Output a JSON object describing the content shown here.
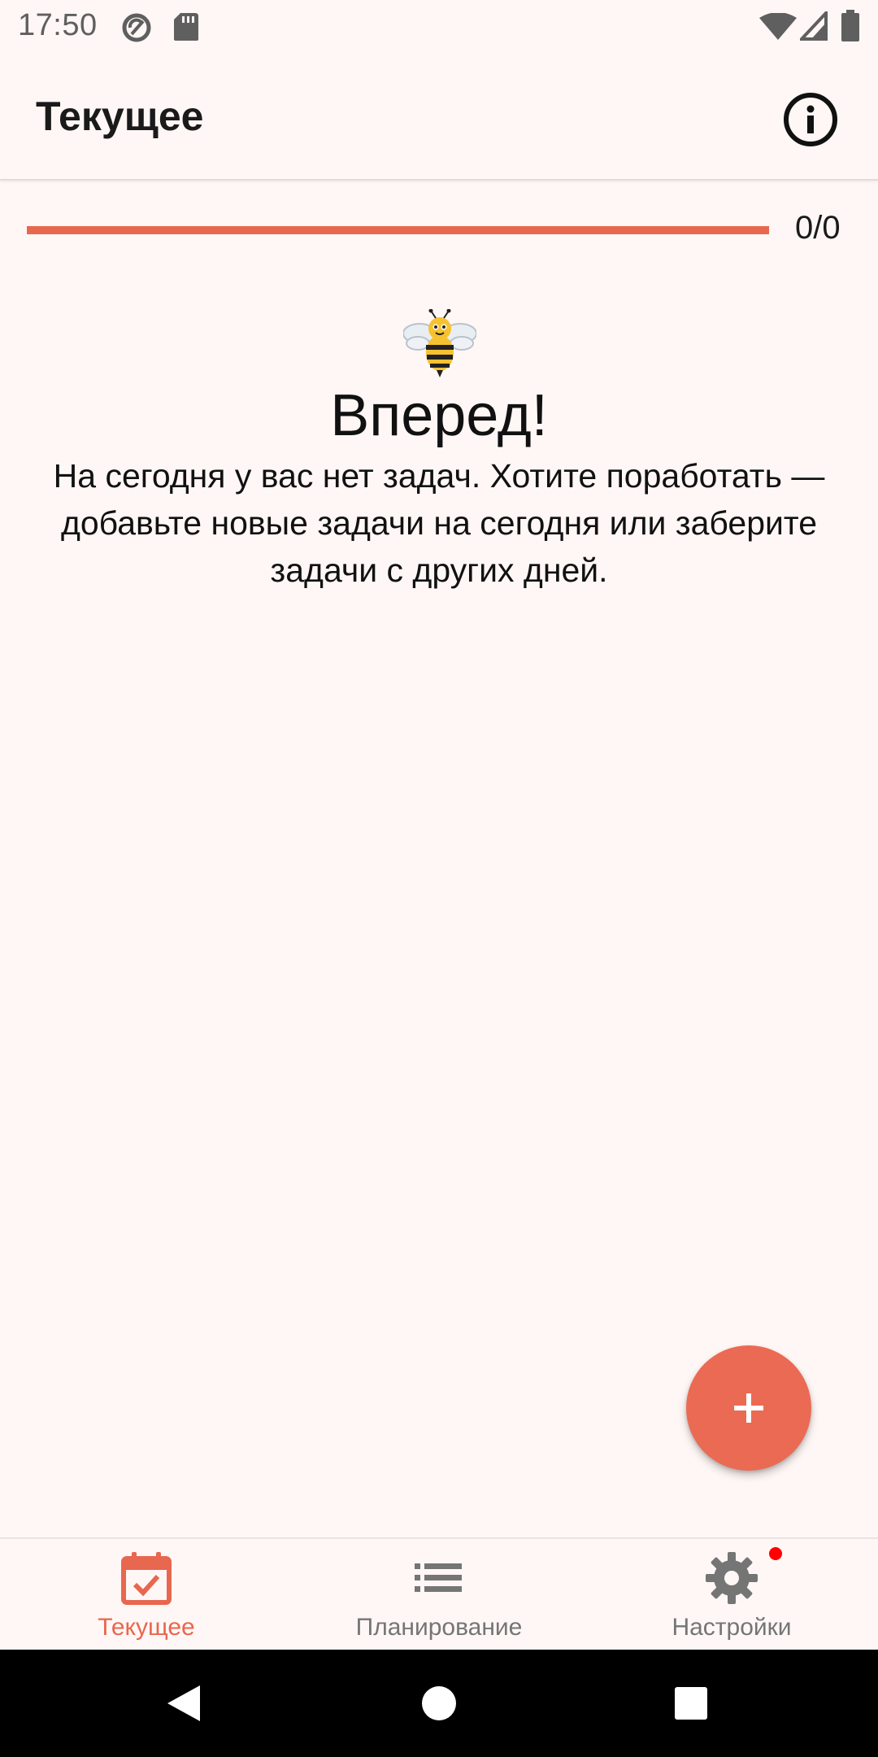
{
  "status_bar": {
    "time": "17:50",
    "icons": [
      "sync-icon",
      "sd-card-icon",
      "wifi-icon",
      "signal-icon",
      "battery-icon"
    ]
  },
  "app_bar": {
    "title": "Текущее",
    "info_icon": "info-icon"
  },
  "progress": {
    "count_text": "0/0",
    "fraction": 1.0,
    "color": "#e8674f"
  },
  "empty_state": {
    "icon": "bee-icon",
    "title": "Вперед!",
    "message": "На сегодня у вас нет задач. Хотите поработать — добавьте новые задачи на сегодня или заберите задачи с других дней."
  },
  "fab": {
    "icon": "plus-icon",
    "color": "#eb6a53"
  },
  "bottom_nav": {
    "items": [
      {
        "label": "Текущее",
        "icon": "calendar-check-icon",
        "active": true
      },
      {
        "label": "Планирование",
        "icon": "list-icon",
        "active": false
      },
      {
        "label": "Настройки",
        "icon": "gear-icon",
        "active": false,
        "badge": true
      }
    ]
  },
  "system_nav": {
    "buttons": [
      "back-icon",
      "home-icon",
      "recents-icon"
    ]
  },
  "colors": {
    "accent": "#e8674f",
    "background": "#fff7f5",
    "inactive": "#757575"
  }
}
